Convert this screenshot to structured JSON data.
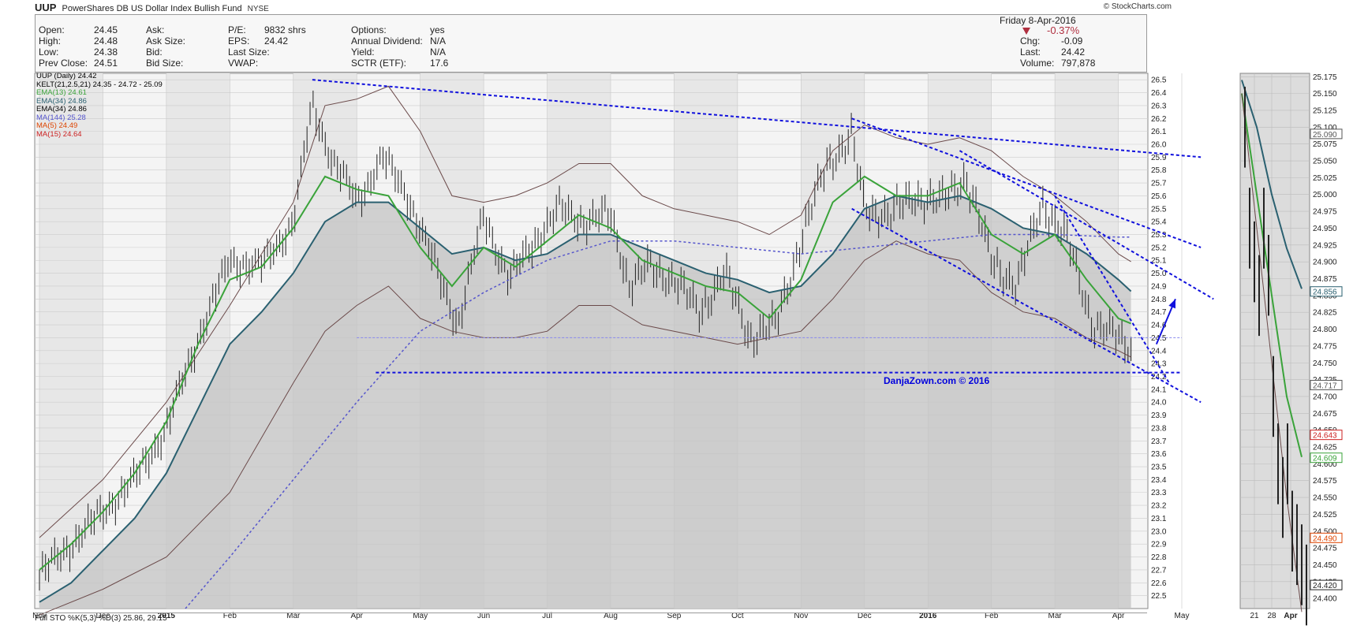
{
  "header": {
    "symbol": "UUP",
    "name": "PowerShares DB US Dollar Index Bullish Fund",
    "exchange": "NYSE",
    "site": "© StockCharts.com",
    "date": "Friday  8-Apr-2016",
    "change_pct": "-0.37%",
    "down_color": "#b03040"
  },
  "quote": {
    "col1": [
      {
        "label": "Open:",
        "value": "24.45"
      },
      {
        "label": "High:",
        "value": "24.48"
      },
      {
        "label": "Low:",
        "value": "24.38"
      },
      {
        "label": "Prev Close:",
        "value": "24.51"
      }
    ],
    "col2": [
      "Ask:",
      "Ask Size:",
      "Bid:",
      "Bid Size:"
    ],
    "col3": [
      {
        "label": "P/E:",
        "value": ""
      },
      {
        "label": "EPS:",
        "value": ""
      },
      {
        "label": "Last Size:",
        "value": "9832 shrs"
      },
      {
        "label": "VWAP:",
        "value": "24.42"
      }
    ],
    "col4": [
      {
        "label": "Options:",
        "value": "yes"
      },
      {
        "label": "Annual Dividend:",
        "value": "N/A"
      },
      {
        "label": "Yield:",
        "value": "N/A"
      },
      {
        "label": "SCTR (ETF):",
        "value": "17.6"
      }
    ],
    "col5": [
      {
        "label": "Chg:",
        "value": "-0.09"
      },
      {
        "label": "Last:",
        "value": "24.42"
      },
      {
        "label": "Volume:",
        "value": "797,878"
      }
    ]
  },
  "legend": [
    {
      "text": "UUP (Daily) 24.42",
      "color": "#000000"
    },
    {
      "text": "KELT(21,2.5,21) 24.35 - 24.72 - 25.09",
      "color": "#000000"
    },
    {
      "text": "EMA(13) 24.61",
      "color": "#3aa33a"
    },
    {
      "text": "EMA(34) 24.86",
      "color": "#2a6070"
    },
    {
      "text": "EMA(34) 24.86",
      "color": "#000000"
    },
    {
      "text": "MA(144) 25.28",
      "color": "#5555cc"
    },
    {
      "text": "MA(5) 24.49",
      "color": "#dd4400"
    },
    {
      "text": "MA(15) 24.64",
      "color": "#cc2222"
    }
  ],
  "watermark": "DanjaZown.com © 2016",
  "sto_label": "Full STO %K(5,3) %D(3) 25.86, 29.15",
  "chart_data": [
    {
      "type": "line",
      "title": "",
      "x_ticks": [
        "Nov",
        "Dec",
        "2015",
        "Feb",
        "Mar",
        "Apr",
        "May",
        "Jun",
        "Jul",
        "Aug",
        "Sep",
        "Oct",
        "Nov",
        "Dec",
        "2016",
        "Feb",
        "Mar",
        "Apr",
        "May"
      ],
      "y_ticks": [
        22.5,
        22.6,
        22.7,
        22.8,
        22.9,
        23.0,
        23.1,
        23.2,
        23.3,
        23.4,
        23.5,
        23.6,
        23.7,
        23.8,
        23.9,
        24.0,
        24.1,
        24.2,
        24.3,
        24.4,
        24.5,
        24.6,
        24.7,
        24.8,
        24.9,
        25.0,
        25.1,
        25.2,
        25.3,
        25.4,
        25.5,
        25.6,
        25.7,
        25.8,
        25.9,
        26.0,
        26.1,
        26.2,
        26.3,
        26.4,
        26.5
      ],
      "ylim": [
        22.4,
        26.55
      ],
      "x_months": [
        0,
        1,
        2,
        3,
        4,
        5,
        6,
        7,
        8,
        9,
        10,
        11,
        12,
        13,
        14,
        15,
        16,
        17,
        18
      ],
      "series": [
        {
          "key": "price",
          "color": "#222222",
          "x": [
            0,
            0.5,
            1,
            1.5,
            2,
            2.5,
            3,
            3.5,
            4,
            4.3,
            4.6,
            5,
            5.4,
            5.8,
            6.2,
            6.6,
            7,
            7.4,
            7.8,
            8.2,
            8.6,
            9,
            9.3,
            9.6,
            10,
            10.4,
            10.8,
            11.2,
            11.6,
            12,
            12.4,
            12.8,
            13,
            13.4,
            13.8,
            14.2,
            14.6,
            15,
            15.4,
            15.8,
            16.2,
            16.6,
            17,
            17.2
          ],
          "values": [
            22.65,
            22.9,
            23.15,
            23.4,
            23.8,
            24.5,
            25.1,
            25.05,
            25.4,
            26.3,
            25.9,
            25.55,
            25.9,
            25.6,
            25.1,
            24.6,
            25.45,
            24.95,
            25.25,
            25.5,
            25.4,
            25.45,
            24.9,
            25.05,
            24.95,
            24.7,
            25.0,
            24.5,
            24.6,
            25.25,
            25.85,
            26.05,
            25.5,
            25.45,
            25.6,
            25.55,
            25.75,
            25.1,
            24.9,
            25.55,
            25.25,
            24.6,
            24.5,
            24.42
          ]
        },
        {
          "key": "ema13",
          "color": "#3aa33a",
          "x": [
            0,
            0.5,
            1,
            1.5,
            2,
            2.5,
            3,
            3.5,
            4,
            4.5,
            5,
            5.5,
            6,
            6.5,
            7,
            7.5,
            8,
            8.5,
            9,
            9.5,
            10,
            10.5,
            11,
            11.5,
            12,
            12.5,
            13,
            13.5,
            14,
            14.5,
            15,
            15.5,
            16,
            16.5,
            17,
            17.2
          ],
          "values": [
            22.7,
            22.9,
            23.15,
            23.45,
            23.85,
            24.45,
            24.95,
            25.05,
            25.35,
            25.75,
            25.65,
            25.6,
            25.2,
            24.9,
            25.2,
            25.05,
            25.25,
            25.45,
            25.35,
            25.1,
            25.0,
            24.9,
            24.85,
            24.65,
            24.95,
            25.55,
            25.75,
            25.6,
            25.6,
            25.7,
            25.3,
            25.15,
            25.3,
            24.95,
            24.65,
            24.61
          ]
        },
        {
          "key": "ema34",
          "color": "#2a6070",
          "x": [
            0,
            0.5,
            1,
            1.5,
            2,
            2.5,
            3,
            3.5,
            4,
            4.5,
            5,
            5.5,
            6,
            6.5,
            7,
            7.5,
            8,
            8.5,
            9,
            9.5,
            10,
            10.5,
            11,
            11.5,
            12,
            12.5,
            13,
            13.5,
            14,
            14.5,
            15,
            15.5,
            16,
            16.5,
            17,
            17.2
          ],
          "values": [
            22.45,
            22.6,
            22.85,
            23.1,
            23.45,
            23.95,
            24.45,
            24.7,
            25.0,
            25.4,
            25.55,
            25.55,
            25.35,
            25.15,
            25.2,
            25.1,
            25.15,
            25.3,
            25.3,
            25.2,
            25.1,
            25.0,
            24.95,
            24.85,
            24.9,
            25.15,
            25.5,
            25.6,
            25.55,
            25.6,
            25.5,
            25.35,
            25.3,
            25.15,
            24.95,
            24.86
          ]
        },
        {
          "key": "ma144",
          "color": "#5555cc",
          "x": [
            2.3,
            3,
            4,
            5,
            6,
            7,
            8,
            9,
            10,
            11,
            12,
            13,
            14,
            15,
            16,
            17,
            17.2
          ],
          "values": [
            22.4,
            22.8,
            23.4,
            24.0,
            24.55,
            24.85,
            25.1,
            25.25,
            25.25,
            25.2,
            25.15,
            25.2,
            25.25,
            25.3,
            25.3,
            25.28,
            25.28
          ]
        },
        {
          "key": "kelt_upper",
          "color": "#6b4a4a",
          "x": [
            0,
            1,
            2,
            3,
            4,
            4.5,
            5,
            5.5,
            6,
            6.5,
            7,
            7.5,
            8,
            8.5,
            9,
            9.5,
            10,
            10.5,
            11,
            11.5,
            12,
            12.5,
            13,
            13.5,
            14,
            14.5,
            15,
            15.5,
            16,
            16.5,
            17,
            17.2
          ],
          "values": [
            22.95,
            23.4,
            24.0,
            24.75,
            25.55,
            26.3,
            26.35,
            26.45,
            26.1,
            25.6,
            25.55,
            25.6,
            25.7,
            25.85,
            25.85,
            25.6,
            25.5,
            25.45,
            25.4,
            25.3,
            25.45,
            25.95,
            26.15,
            26.05,
            26.0,
            26.05,
            25.95,
            25.75,
            25.6,
            25.4,
            25.15,
            25.09
          ]
        },
        {
          "key": "kelt_lower",
          "color": "#6b4a4a",
          "x": [
            0,
            1,
            2,
            3,
            4,
            4.5,
            5,
            5.5,
            6,
            6.5,
            7,
            7.5,
            8,
            8.5,
            9,
            9.5,
            10,
            10.5,
            11,
            11.5,
            12,
            12.5,
            13,
            13.5,
            14,
            14.5,
            15,
            15.5,
            16,
            16.5,
            17,
            17.2
          ],
          "values": [
            22.35,
            22.55,
            22.8,
            23.3,
            24.15,
            24.55,
            24.75,
            24.9,
            24.65,
            24.55,
            24.5,
            24.5,
            24.55,
            24.75,
            24.75,
            24.6,
            24.55,
            24.5,
            24.45,
            24.5,
            24.55,
            24.8,
            25.1,
            25.25,
            25.15,
            25.1,
            24.85,
            24.7,
            24.65,
            24.5,
            24.4,
            24.35
          ]
        }
      ],
      "trendlines": [
        {
          "x1": 4.3,
          "y1": 26.5,
          "x2": 18.3,
          "y2": 25.9
        },
        {
          "x1": 12.8,
          "y1": 26.2,
          "x2": 18.3,
          "y2": 25.2
        },
        {
          "x1": 14.5,
          "y1": 25.95,
          "x2": 18.5,
          "y2": 24.8
        },
        {
          "x1": 16.0,
          "y1": 25.6,
          "x2": 17.8,
          "y2": 24.15
        },
        {
          "x1": 12.8,
          "y1": 25.5,
          "x2": 18.3,
          "y2": 24.0
        },
        {
          "x1": 5.3,
          "y1": 24.23,
          "x2": 18.0,
          "y2": 24.23
        },
        {
          "x1": 5.0,
          "y1": 24.5,
          "x2": 18.0,
          "y2": 24.5
        }
      ],
      "arrow": {
        "x1": 17.6,
        "y1": 24.45,
        "x2": 17.9,
        "y2": 24.8
      }
    },
    {
      "type": "line",
      "title": "",
      "x_ticks": [
        "21",
        "28",
        "Apr"
      ],
      "y_ticks": [
        24.4,
        24.425,
        24.45,
        24.475,
        24.5,
        24.525,
        24.55,
        24.575,
        24.6,
        24.625,
        24.65,
        24.675,
        24.7,
        24.725,
        24.75,
        24.775,
        24.8,
        24.825,
        24.85,
        24.875,
        24.9,
        24.925,
        24.95,
        24.975,
        25.0,
        25.025,
        25.05,
        25.075,
        25.1,
        25.125,
        25.15,
        25.175
      ],
      "ylim": [
        24.385,
        25.18
      ],
      "price_tags": [
        {
          "value": "25.090",
          "y": 25.09,
          "color": "#555555"
        },
        {
          "value": "24.856",
          "y": 24.856,
          "color": "#2a6070"
        },
        {
          "value": "24.717",
          "y": 24.717,
          "color": "#555555"
        },
        {
          "value": "24.643",
          "y": 24.643,
          "color": "#cc2222"
        },
        {
          "value": "24.609",
          "y": 24.609,
          "color": "#3aa33a"
        },
        {
          "value": "24.490",
          "y": 24.49,
          "color": "#dd4400"
        },
        {
          "value": "24.420",
          "y": 24.42,
          "color": "#222222"
        }
      ]
    }
  ]
}
